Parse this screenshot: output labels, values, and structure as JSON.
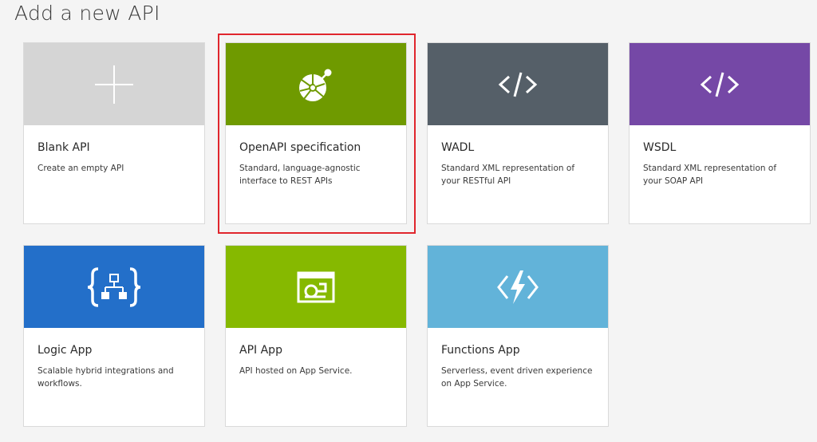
{
  "page": {
    "title": "Add a new API"
  },
  "cards": [
    {
      "title": "Blank API",
      "description": "Create an empty API",
      "icon": "plus-icon",
      "color": "#d5d5d5"
    },
    {
      "title": "OpenAPI specification",
      "description": "Standard, language-agnostic interface to REST APIs",
      "icon": "openapi-icon",
      "color": "#6f9a00",
      "selected": true
    },
    {
      "title": "WADL",
      "description": "Standard XML representation of your RESTful API",
      "icon": "code-icon",
      "color": "#555f68"
    },
    {
      "title": "WSDL",
      "description": "Standard XML representation of your SOAP API",
      "icon": "code-icon",
      "color": "#7548a6"
    },
    {
      "title": "Logic App",
      "description": "Scalable hybrid integrations and workflows.",
      "icon": "logic-app-icon",
      "color": "#236fc9"
    },
    {
      "title": "API App",
      "description": "API hosted on App Service.",
      "icon": "api-app-icon",
      "color": "#86b900"
    },
    {
      "title": "Functions App",
      "description": "Serverless, event driven experience on App Service.",
      "icon": "functions-icon",
      "color": "#62b3d9"
    }
  ],
  "selection_color": "#e0262d"
}
